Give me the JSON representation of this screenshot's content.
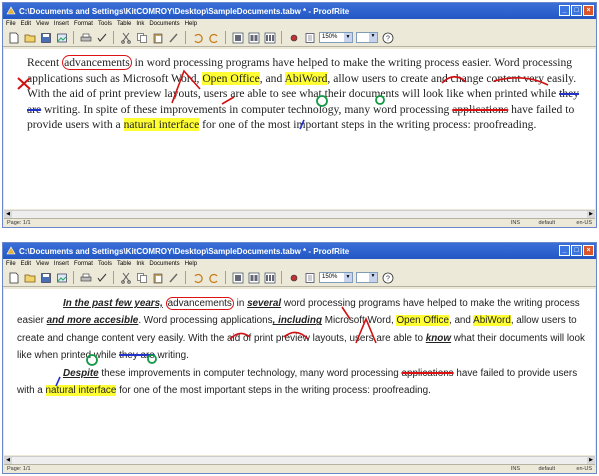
{
  "window1": {
    "title": "C:\\Documents and Settings\\KitCOMROY\\Desktop\\SampleDocuments.tabw * - ProofRite",
    "menu": [
      "File",
      "Edit",
      "View",
      "Insert",
      "Format",
      "Tools",
      "Table",
      "Ink",
      "Documents",
      "Help"
    ],
    "zoom": "150%",
    "status": {
      "page": "Page: 1/1",
      "mode": "INS",
      "style": "default",
      "lang": "en-US"
    },
    "text": {
      "s1a": "Recent ",
      "s1b": "advancements",
      "s1c": " in word processing programs have helped to make the writing process easier. ",
      "s2a": "Word processing applications such as Microsoft Word, ",
      "s2b": "Open Office",
      "s2c": ", and ",
      "s2d": "AbiWord",
      "s2e": ", allow users to create and change content very easily. With the aid of print preview layouts, users are able to see what their documents will look like when printed while ",
      "s2f": "they are",
      "s2g": " writing. In spite of these improvements in computer technology, many word processing ",
      "s2h": "applications",
      "s2i": " have failed to provide users with a ",
      "s2j": "natural interface",
      "s2k": " for one of the most important steps in the writing process: proofreading."
    }
  },
  "window2": {
    "title": "C:\\Documents and Settings\\KitCOMROY\\Desktop\\SampleDocuments.tabw * - ProofRite",
    "menu": [
      "File",
      "Edit",
      "View",
      "Insert",
      "Format",
      "Tools",
      "Table",
      "Ink",
      "Documents",
      "Help"
    ],
    "zoom": "150%",
    "status": {
      "page": "Page: 1/1",
      "mode": "INS",
      "style": "default",
      "lang": "en-US"
    },
    "text": {
      "p1a": "In the past few years,",
      "p1b": " ",
      "p1c": "advancements",
      "p1d": " in ",
      "p1e": "several",
      "p1f": " word processing programs have helped to make the writing process easier ",
      "p1g": "and more accesible",
      "p1h": ". Word processing applications",
      "p1i": ", including",
      "p1j": " Microsoft Word, ",
      "p1k": "Open Office",
      "p1l": ", and ",
      "p1m": "AbiWord",
      "p1n": ", allow users to create and change content very easily. With the aid of print preview layouts, users are able to ",
      "p1o": "know",
      "p1p": " what their documents will look like when printed while ",
      "p1q": "they are",
      "p1r": " writing.",
      "p2a": "Despite",
      "p2b": " these improvements in computer technology, many word processing ",
      "p2c": "applications",
      "p2d": " have failed to provide users with a ",
      "p2e": "natural interface",
      "p2f": " for one of the most important steps in the writing process: proofreading."
    }
  },
  "colors": {
    "titlebar": "#2357c4",
    "highlight": "#ffff33",
    "ink_red": "#d11111",
    "ink_blue": "#2233cc",
    "ink_green": "#119944"
  }
}
